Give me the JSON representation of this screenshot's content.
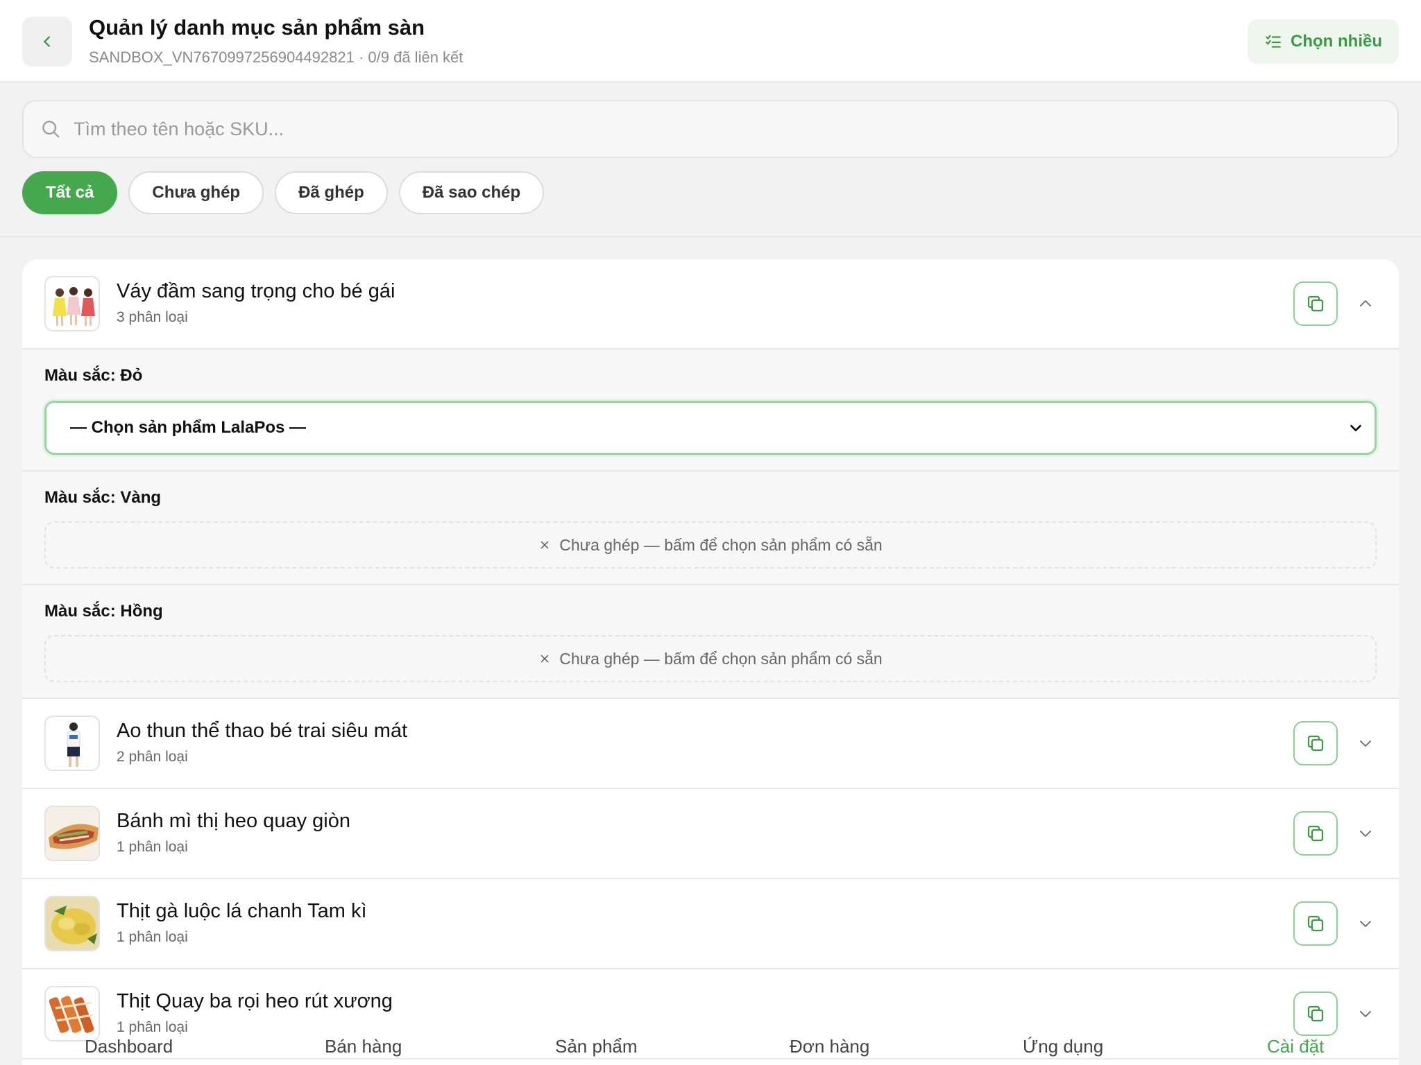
{
  "header": {
    "title": "Quản lý danh mục sản phẩm sàn",
    "subtitle": "SANDBOX_VN7670997256904492821 · 0/9 đã liên kết",
    "multi_select_label": "Chọn nhiều"
  },
  "search": {
    "placeholder": "Tìm theo tên hoặc SKU..."
  },
  "filters": [
    {
      "label": "Tất cả",
      "active": true
    },
    {
      "label": "Chưa ghép",
      "active": false
    },
    {
      "label": "Đã ghép",
      "active": false
    },
    {
      "label": "Đã sao chép",
      "active": false
    }
  ],
  "products": [
    {
      "name": "Váy đầm sang trọng cho bé gái",
      "count": "3 phân loại",
      "expanded": true,
      "variants": [
        {
          "label": "Màu sắc: Đỏ",
          "select_text": "— Chọn sản phẩm LalaPos —"
        },
        {
          "label": "Màu sắc: Vàng",
          "unmatched_text": "Chưa ghép — bấm để chọn sản phẩm có sẵn"
        },
        {
          "label": "Màu sắc: Hồng",
          "unmatched_text": "Chưa ghép — bấm để chọn sản phẩm có sẵn"
        }
      ]
    },
    {
      "name": "Ao thun thể thao bé trai siêu mát",
      "count": "2 phân loại"
    },
    {
      "name": "Bánh mì thị heo quay giòn",
      "count": "1 phân loại"
    },
    {
      "name": "Thịt gà luộc lá chanh Tam kì",
      "count": "1 phân loại"
    },
    {
      "name": "Thịt Quay ba rọi heo rút xương",
      "count": "1 phân loại"
    }
  ],
  "bottom_nav": [
    "Dashboard",
    "Bán hàng",
    "Sản phẩm",
    "Đơn hàng",
    "Ứng dụng",
    "Cài đặt"
  ],
  "colors": {
    "accent": "#45a84e",
    "accent_light": "#eef6ee"
  }
}
